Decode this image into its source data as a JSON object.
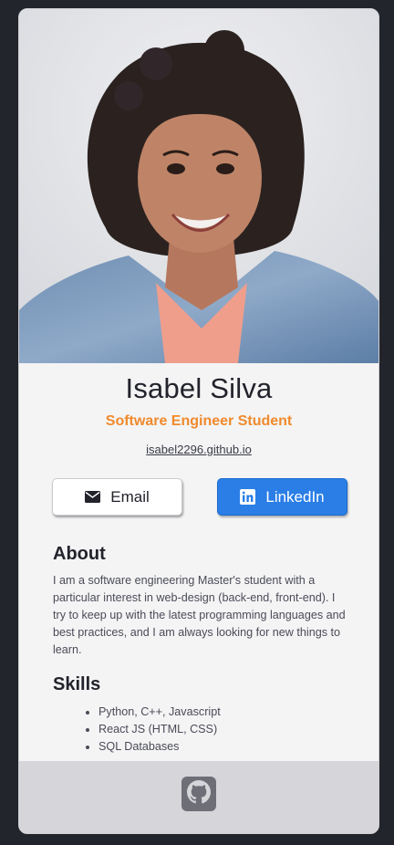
{
  "profile": {
    "name": "Isabel Silva",
    "role": "Software Engineer Student",
    "website": "isabel2296.github.io"
  },
  "buttons": {
    "email_label": "Email",
    "linkedin_label": "LinkedIn"
  },
  "about": {
    "heading": "About",
    "text": "I am a software engineering Master's student with a particular interest in web-design (back-end, front-end). I try to keep up with the latest programming languages and best practices, and I am always looking for new things to learn."
  },
  "skills": {
    "heading": "Skills",
    "items": [
      "Python, C++, Javascript",
      "React JS (HTML, CSS)",
      "SQL Databases"
    ]
  },
  "footer": {
    "icon": "github-icon"
  },
  "colors": {
    "accent": "#f08a2c",
    "linkedin": "#2a7ee6",
    "background": "#23252c",
    "card": "#f4f4f5",
    "footer": "#d5d5da"
  }
}
